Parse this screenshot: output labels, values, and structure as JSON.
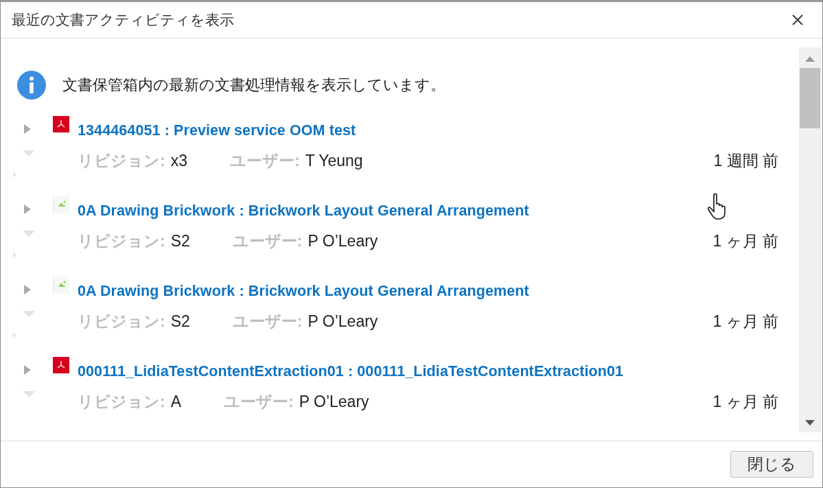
{
  "window": {
    "title": "最近の文書アクティビティを表示"
  },
  "info": "文書保管箱内の最新の文書処理情報を表示しています。",
  "items": [
    {
      "kind": "pdf",
      "title": "1344464051 : Preview service OOM test",
      "revision_label": "リビジョン:",
      "revision": "x3",
      "user_label": "ユーザー:",
      "user": "T Yeung",
      "time": "1 週間 前"
    },
    {
      "kind": "image",
      "title": "0A Drawing Brickwork : Brickwork Layout General Arrangement",
      "revision_label": "リビジョン:",
      "revision": "S2",
      "user_label": "ユーザー:",
      "user": "P O’Leary",
      "time": "1 ヶ月 前"
    },
    {
      "kind": "image",
      "title": "0A Drawing Brickwork : Brickwork Layout General Arrangement",
      "revision_label": "リビジョン:",
      "revision": "S2",
      "user_label": "ユーザー:",
      "user": "P O’Leary",
      "time": "1 ヶ月 前"
    },
    {
      "kind": "pdf",
      "title": "000111_LidiaTestContentExtraction01 : 000111_LidiaTestContentExtraction01",
      "revision_label": "リビジョン:",
      "revision": "A",
      "user_label": "ユーザー:",
      "user": "P O’Leary",
      "time": "1 ヶ月 前"
    }
  ],
  "buttons": [
    "閉じる"
  ]
}
